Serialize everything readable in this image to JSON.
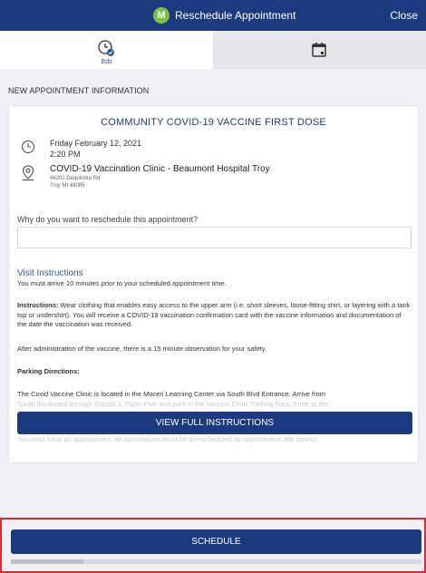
{
  "header": {
    "brand_letter": "M",
    "title": "Reschedule Appointment",
    "close_label": "Close"
  },
  "tabs": {
    "edit_label": "Edit",
    "edit_icon": "clock-check-icon",
    "calendar_icon": "calendar-icon"
  },
  "section": {
    "label": "NEW APPOINTMENT INFORMATION"
  },
  "appointment": {
    "title": "COMMUNITY COVID-19 VACCINE FIRST DOSE",
    "date": "Friday February 12, 2021",
    "time": "2:20 PM",
    "location_name": "COVID-19 Vaccination Clinic - Beaumont Hospital Troy",
    "address_line1": "44201 Dequindre Rd",
    "address_line2": "Troy MI 48085"
  },
  "reason": {
    "label": "Why do you want to reschedule this appointment?",
    "placeholder": "",
    "value": ""
  },
  "instructions": {
    "heading": "Visit Instructions",
    "arrive_note": "You must arrive 10 minutes prior to your scheduled appointment time.",
    "instructions_label": "Instructions:",
    "instructions_text": "Wear clothing that enables easy access to the upper arm (i.e. short sleeves, loose-fitting shirt, or layering with a tank top or undershirt). You will receive a COVID-19 vaccination confirmation card with the vaccine information and documentation of the date the vaccination was received.",
    "observation_text": "After administration of the vaccine, there is a 15 minute observation for your safety.",
    "parking_label": "Parking Directions:",
    "parking_text": "The Covid Vaccine Clinic is located in the Moceri Learning Center via South Blvd Entrance.  Arrive from",
    "parking_text_faded": "South Boulevard through Donald J. Flynn Park and park in the Vaccine Clinic Parking Area.  Enter to the",
    "faded_tail": "You must have an appointment.  All vaccinations must be pre-scheduled by appointment.  We cannot",
    "view_full_label": "VIEW FULL INSTRUCTIONS"
  },
  "footer": {
    "schedule_label": "SCHEDULE"
  },
  "colors": {
    "primary": "#1b3a80",
    "link": "#2a5aa8",
    "brand_green": "#7cc242",
    "highlight_border": "#d32f2f"
  }
}
